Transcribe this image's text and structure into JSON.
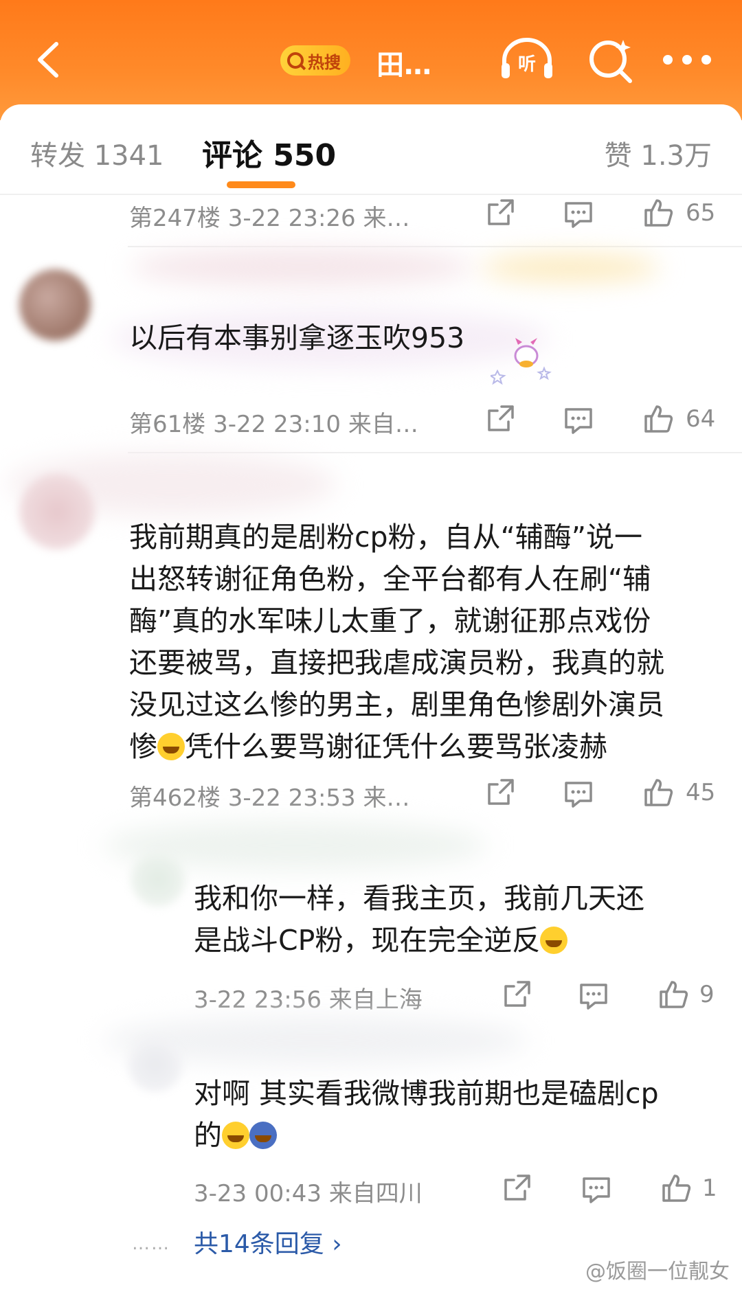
{
  "header": {
    "hot_badge": "热搜",
    "hot_title": "田…",
    "listen_label": "听"
  },
  "tabs": {
    "forward": "转发 1341",
    "comment": "评论 550",
    "like": "赞 1.3万"
  },
  "comments": [
    {
      "meta": "第247楼  3-22 23:26  来…",
      "likes": "65"
    },
    {
      "text": "以后有本事别拿逐玉吹953",
      "meta": "第61楼  3-22 23:10  来自…",
      "likes": "64"
    },
    {
      "text_lines": [
        "我前期真的是剧粉cp粉，自从“辅酶”说一",
        "出怒转谢征角色粉，全平台都有人在刷“辅",
        "酶”真的水军味儿太重了，就谢征那点戏份",
        "还要被骂，直接把我虐成演员粉，我真的就",
        "没见过这么惨的男主，剧里角色惨剧外演员",
        "凭什么要骂谢征凭什么要骂张凌赫"
      ],
      "line6_prefix": "惨",
      "meta": "第462楼  3-22 23:53  来…",
      "likes": "45"
    }
  ],
  "replies": [
    {
      "line1": "我和你一样，看我主页，我前几天还",
      "line2": "是战斗CP粉，现在完全逆反",
      "meta": "3-22 23:56  来自上海",
      "likes": "9"
    },
    {
      "line1": "对啊 其实看我微博我前期也是磕剧cp",
      "line2": "的",
      "meta": "3-23 00:43  来自四川",
      "likes": "1"
    }
  ],
  "more_replies": "共14条回复 ›",
  "more_dots": "……",
  "watermark": "@饭圈一位靓女",
  "colors": {
    "brand": "#ff8a1a",
    "link": "#2b5aa8"
  }
}
